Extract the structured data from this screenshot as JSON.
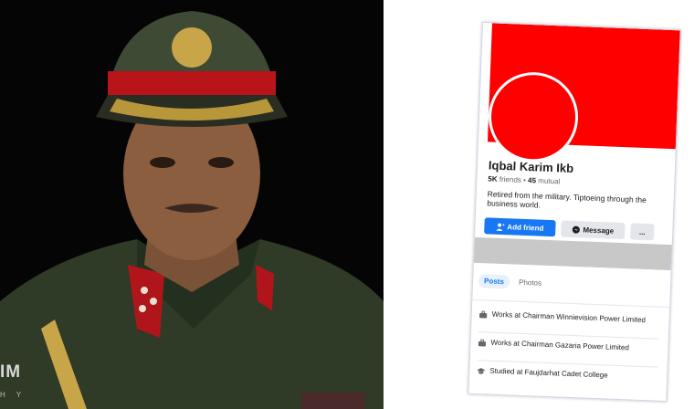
{
  "portrait": {
    "watermark": "IM",
    "watermark_sub": "HY"
  },
  "profile": {
    "name": "Iqbal Karim Ikb",
    "friends_count": "5K",
    "friends_label": "friends",
    "separator": "•",
    "mutual_count": "45",
    "mutual_label": "mutual",
    "bio": "Retired from the military. Tiptoeing through the business world.",
    "colors": {
      "cover": "#fe0000",
      "primary_button": "#1877f2",
      "secondary_button": "#e4e6eb"
    }
  },
  "actions": {
    "add_friend": "Add friend",
    "message": "Message",
    "more": "..."
  },
  "tabs": [
    {
      "label": "Posts",
      "active": true
    },
    {
      "label": "Photos",
      "active": false
    }
  ],
  "details": [
    {
      "icon": "briefcase-icon",
      "text": "Works at Chairman Winnievision Power Limited"
    },
    {
      "icon": "briefcase-icon",
      "text": "Works at Chairman Gazaria Power Limited"
    },
    {
      "icon": "graduation-cap-icon",
      "text": "Studied at Faujdarhat Cadet College"
    }
  ]
}
